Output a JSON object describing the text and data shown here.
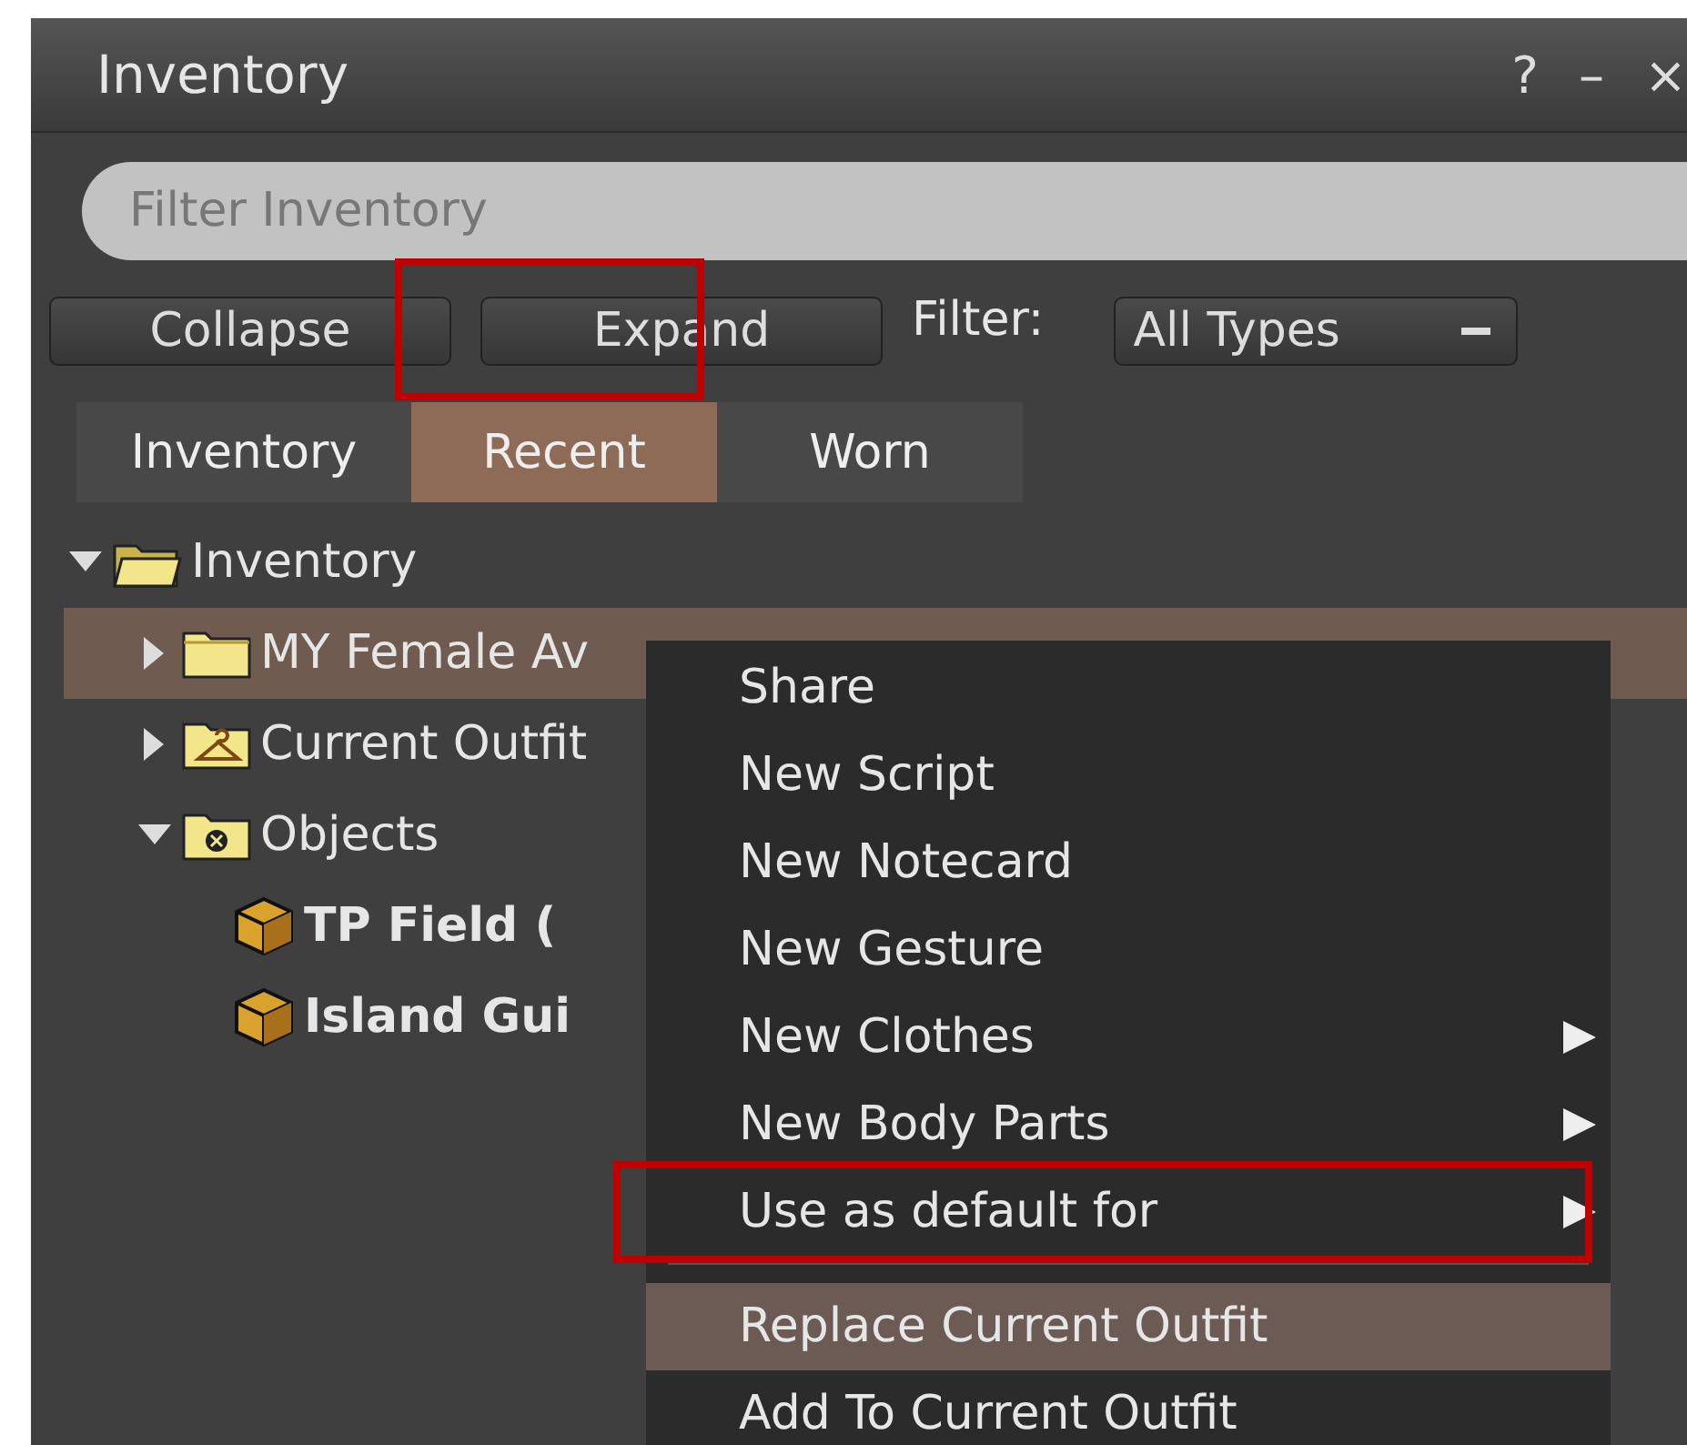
{
  "window": {
    "title": "Inventory",
    "controls": [
      "?",
      "–",
      "×"
    ]
  },
  "search": {
    "placeholder": "Filter Inventory"
  },
  "toolbar": {
    "buttons": [
      {
        "label": "Collapse",
        "highlighted": false
      },
      {
        "label": "Expand",
        "highlighted": true
      }
    ],
    "filter_label": "Filter:",
    "filter_value": "All Types"
  },
  "tabs": [
    {
      "label": "Inventory",
      "selected": false
    },
    {
      "label": "Recent",
      "selected": true
    },
    {
      "label": "Worn",
      "selected": false
    }
  ],
  "tree": [
    {
      "label": "Inventory",
      "kind": "open-folder",
      "expanded": true,
      "selected": false,
      "bold": false,
      "children": [
        {
          "label": "MY Female Av",
          "kind": "folder",
          "expanded": false,
          "selected": true,
          "bold": false
        },
        {
          "label": "Current Outfit",
          "kind": "outfit",
          "expanded": false,
          "selected": false,
          "bold": false
        },
        {
          "label": "Objects",
          "kind": "objects",
          "expanded": true,
          "selected": false,
          "bold": false,
          "children": [
            {
              "label": "TP Field (",
              "kind": "object",
              "selected": false,
              "bold": true
            },
            {
              "label": "Island Gui",
              "kind": "object",
              "selected": false,
              "bold": true
            }
          ]
        }
      ]
    }
  ],
  "context_menu": [
    {
      "label": "Share",
      "submenu": false,
      "highlighted": false,
      "selected": false
    },
    {
      "label": "New Script",
      "submenu": false,
      "highlighted": false,
      "selected": false
    },
    {
      "label": "New Notecard",
      "submenu": false,
      "highlighted": false,
      "selected": false
    },
    {
      "label": "New Gesture",
      "submenu": false,
      "highlighted": false,
      "selected": false
    },
    {
      "label": "New Clothes",
      "submenu": true,
      "highlighted": false,
      "selected": false
    },
    {
      "label": "New Body Parts",
      "submenu": true,
      "highlighted": false,
      "selected": false
    },
    {
      "label": "Use as default for",
      "submenu": true,
      "highlighted": true,
      "selected": false,
      "separator_after": true
    },
    {
      "label": "Replace Current Outfit",
      "submenu": false,
      "highlighted": false,
      "selected": true
    },
    {
      "label": "Add To Current Outfit",
      "submenu": false,
      "highlighted": false,
      "selected": false
    }
  ]
}
